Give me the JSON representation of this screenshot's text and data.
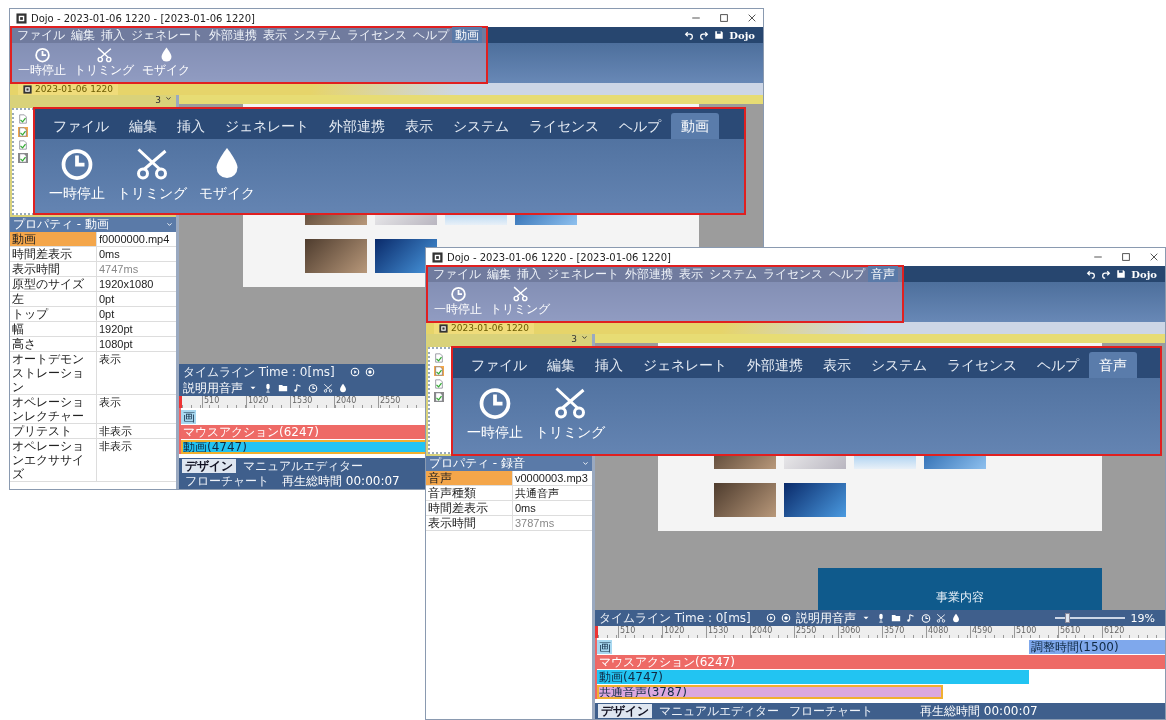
{
  "windows": [
    {
      "title": "Dojo - 2023-01-06 1220 - [2023-01-06 1220]",
      "menu": [
        {
          "label": "ファイル",
          "selected": false
        },
        {
          "label": "編集",
          "selected": false
        },
        {
          "label": "挿入",
          "selected": false
        },
        {
          "label": "ジェネレート",
          "selected": false
        },
        {
          "label": "外部連携",
          "selected": false
        },
        {
          "label": "表示",
          "selected": false
        },
        {
          "label": "システム",
          "selected": false
        },
        {
          "label": "ライセンス",
          "selected": false
        },
        {
          "label": "ヘルプ",
          "selected": false
        },
        {
          "label": "動画",
          "selected": true
        }
      ],
      "logo": "Dojo",
      "ribbon": [
        {
          "label": "一時停止",
          "kind": "clock"
        },
        {
          "label": "トリミング",
          "kind": "scissors"
        },
        {
          "label": "モザイク",
          "kind": "drop"
        }
      ],
      "doc_tab": "2023-01-06 1220",
      "steps_count": "3",
      "properties": {
        "title": "プロパティ - 動画",
        "rows": [
          {
            "name": "動画",
            "value": "f0000000.mp4",
            "selected": true,
            "disabled": false
          },
          {
            "name": "時間差表示",
            "value": "0ms",
            "selected": false,
            "disabled": false
          },
          {
            "name": "表示時間",
            "value": "4747ms",
            "selected": false,
            "disabled": true
          },
          {
            "name": "原型のサイズ",
            "value": "1920x1080",
            "selected": false,
            "disabled": false
          },
          {
            "name": "左",
            "value": "0pt",
            "selected": false,
            "disabled": false
          },
          {
            "name": "トップ",
            "value": "0pt",
            "selected": false,
            "disabled": false
          },
          {
            "name": "幅",
            "value": "1920pt",
            "selected": false,
            "disabled": false
          },
          {
            "name": "高さ",
            "value": "1080pt",
            "selected": false,
            "disabled": false
          },
          {
            "name": "オートデモンストレーション",
            "value": "表示",
            "selected": false,
            "disabled": false
          },
          {
            "name": "オペレーションレクチャー",
            "value": "表示",
            "selected": false,
            "disabled": false
          },
          {
            "name": "プリテスト",
            "value": "非表示",
            "selected": false,
            "disabled": false
          },
          {
            "name": "オペレーションエクササイズ",
            "value": "非表示",
            "selected": false,
            "disabled": false
          }
        ]
      },
      "timeline": {
        "title": "タイムライン Time : 0[ms]",
        "voice": "説明用音声",
        "ticks": [
          "510",
          "1020",
          "1530",
          "2040",
          "2550"
        ],
        "tracks": [
          {
            "segments": [
              {
                "label": "画",
                "color": "#a8d8f0",
                "level": 0.015,
                "selected": false
              }
            ]
          },
          {
            "segments": [
              {
                "label": "マウスアクション(6247)",
                "color": "#ee6a66",
                "level": 1,
                "selected": false
              }
            ]
          },
          {
            "segments": [
              {
                "label": "動画(4747)",
                "color": "#22c4f2",
                "level": 1,
                "selected": true
              }
            ]
          }
        ]
      },
      "bottom_tabs": [
        {
          "label": "デザイン",
          "selected": true
        },
        {
          "label": "マニュアルエディター",
          "selected": false
        },
        {
          "label": "フローチャート",
          "selected": false
        }
      ],
      "total_time": "再生総時間 00:00:07"
    },
    {
      "title": "Dojo - 2023-01-06 1220 - [2023-01-06 1220]",
      "menu": [
        {
          "label": "ファイル",
          "selected": false
        },
        {
          "label": "編集",
          "selected": false
        },
        {
          "label": "挿入",
          "selected": false
        },
        {
          "label": "ジェネレート",
          "selected": false
        },
        {
          "label": "外部連携",
          "selected": false
        },
        {
          "label": "表示",
          "selected": false
        },
        {
          "label": "システム",
          "selected": false
        },
        {
          "label": "ライセンス",
          "selected": false
        },
        {
          "label": "ヘルプ",
          "selected": false
        },
        {
          "label": "音声",
          "selected": true
        }
      ],
      "logo": "Dojo",
      "ribbon": [
        {
          "label": "一時停止",
          "kind": "clock"
        },
        {
          "label": "トリミング",
          "kind": "scissors"
        }
      ],
      "doc_tab": "2023-01-06 1220",
      "steps_count": "3",
      "properties": {
        "title": "プロパティ - 録音",
        "rows": [
          {
            "name": "音声",
            "value": "v0000003.mp3",
            "selected": true,
            "disabled": false
          },
          {
            "name": "音声種類",
            "value": "共通音声",
            "selected": false,
            "disabled": false
          },
          {
            "name": "時間差表示",
            "value": "0ms",
            "selected": false,
            "disabled": false
          },
          {
            "name": "表示時間",
            "value": "3787ms",
            "selected": false,
            "disabled": true
          }
        ]
      },
      "banner": "事業内容",
      "timeline": {
        "title": "タイムライン Time : 0[ms]",
        "voice": "説明用音声",
        "zoom": {
          "level": 0.15,
          "reading": "19%"
        },
        "ticks": [
          "510",
          "1020",
          "1530",
          "2040",
          "2550",
          "3060",
          "3570",
          "4080",
          "4590",
          "5100",
          "5610",
          "6120"
        ],
        "tracks": [
          {
            "segments": [
              {
                "label": "画",
                "color": "#a8d8f0",
                "level": 0.015,
                "selected": false
              },
              {
                "label": "調整時間(1500)",
                "color": "#7fa8ec",
                "level": 0.24,
                "selected": false
              }
            ]
          },
          {
            "segments": [
              {
                "label": "マウスアクション(6247)",
                "color": "#ee6a66",
                "level": 1,
                "selected": false
              }
            ]
          },
          {
            "segments": [
              {
                "label": "動画(4747)",
                "color": "#22c4f2",
                "level": 0.76,
                "selected": false
              }
            ]
          },
          {
            "segments": [
              {
                "label": "共通音声(3787)",
                "color": "#dba8e0",
                "level": 0.61,
                "selected": true
              }
            ]
          }
        ]
      },
      "bottom_tabs": [
        {
          "label": "デザイン",
          "selected": true
        },
        {
          "label": "マニュアルエディター",
          "selected": false
        },
        {
          "label": "フローチャート",
          "selected": false
        }
      ],
      "total_time": "再生総時間 00:00:07"
    }
  ],
  "callouts": [
    {
      "menu": [
        {
          "label": "ファイル",
          "selected": false
        },
        {
          "label": "編集",
          "selected": false
        },
        {
          "label": "挿入",
          "selected": false
        },
        {
          "label": "ジェネレート",
          "selected": false
        },
        {
          "label": "外部連携",
          "selected": false
        },
        {
          "label": "表示",
          "selected": false
        },
        {
          "label": "システム",
          "selected": false
        },
        {
          "label": "ライセンス",
          "selected": false
        },
        {
          "label": "ヘルプ",
          "selected": false
        },
        {
          "label": "動画",
          "selected": true
        }
      ],
      "ribbon": [
        {
          "label": "一時停止",
          "kind": "clock"
        },
        {
          "label": "トリミング",
          "kind": "scissors"
        },
        {
          "label": "モザイク",
          "kind": "drop"
        }
      ]
    },
    {
      "menu": [
        {
          "label": "ファイル",
          "selected": false
        },
        {
          "label": "編集",
          "selected": false
        },
        {
          "label": "挿入",
          "selected": false
        },
        {
          "label": "ジェネレート",
          "selected": false
        },
        {
          "label": "外部連携",
          "selected": false
        },
        {
          "label": "表示",
          "selected": false
        },
        {
          "label": "システム",
          "selected": false
        },
        {
          "label": "ライセンス",
          "selected": false
        },
        {
          "label": "ヘルプ",
          "selected": false
        },
        {
          "label": "音声",
          "selected": true
        }
      ],
      "ribbon": [
        {
          "label": "一時停止",
          "kind": "clock"
        },
        {
          "label": "トリミング",
          "kind": "scissors"
        }
      ]
    }
  ]
}
